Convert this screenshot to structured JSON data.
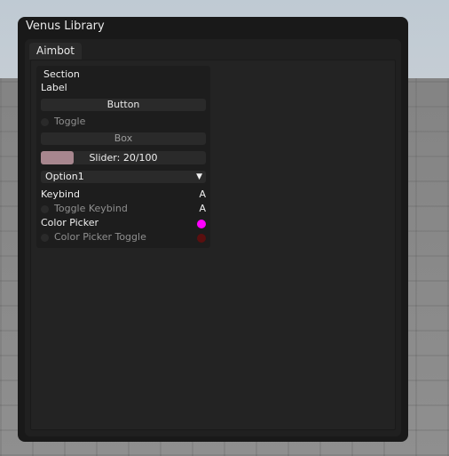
{
  "window": {
    "title": "Venus Library"
  },
  "tabs": [
    {
      "label": "Aimbot"
    }
  ],
  "section": {
    "title": "Section",
    "label": "Label",
    "button_label": "Button",
    "toggle_label": "Toggle",
    "box_placeholder": "Box",
    "slider": {
      "label": "Slider: 20/100",
      "value": 20,
      "max": 100
    },
    "dropdown": {
      "selected": "Option1",
      "caret": "▼"
    },
    "keybind": {
      "label": "Keybind",
      "key": "A"
    },
    "toggle_keybind": {
      "label": "Toggle Keybind",
      "key": "A"
    },
    "color_picker": {
      "label": "Color Picker",
      "color": "#ff00ff"
    },
    "color_picker_toggle": {
      "label": "Color Picker Toggle",
      "color": "#5a0f0f"
    }
  },
  "colors": {
    "accent": "#a7868e",
    "panel": "#1d1d1d",
    "window": "#191919"
  }
}
